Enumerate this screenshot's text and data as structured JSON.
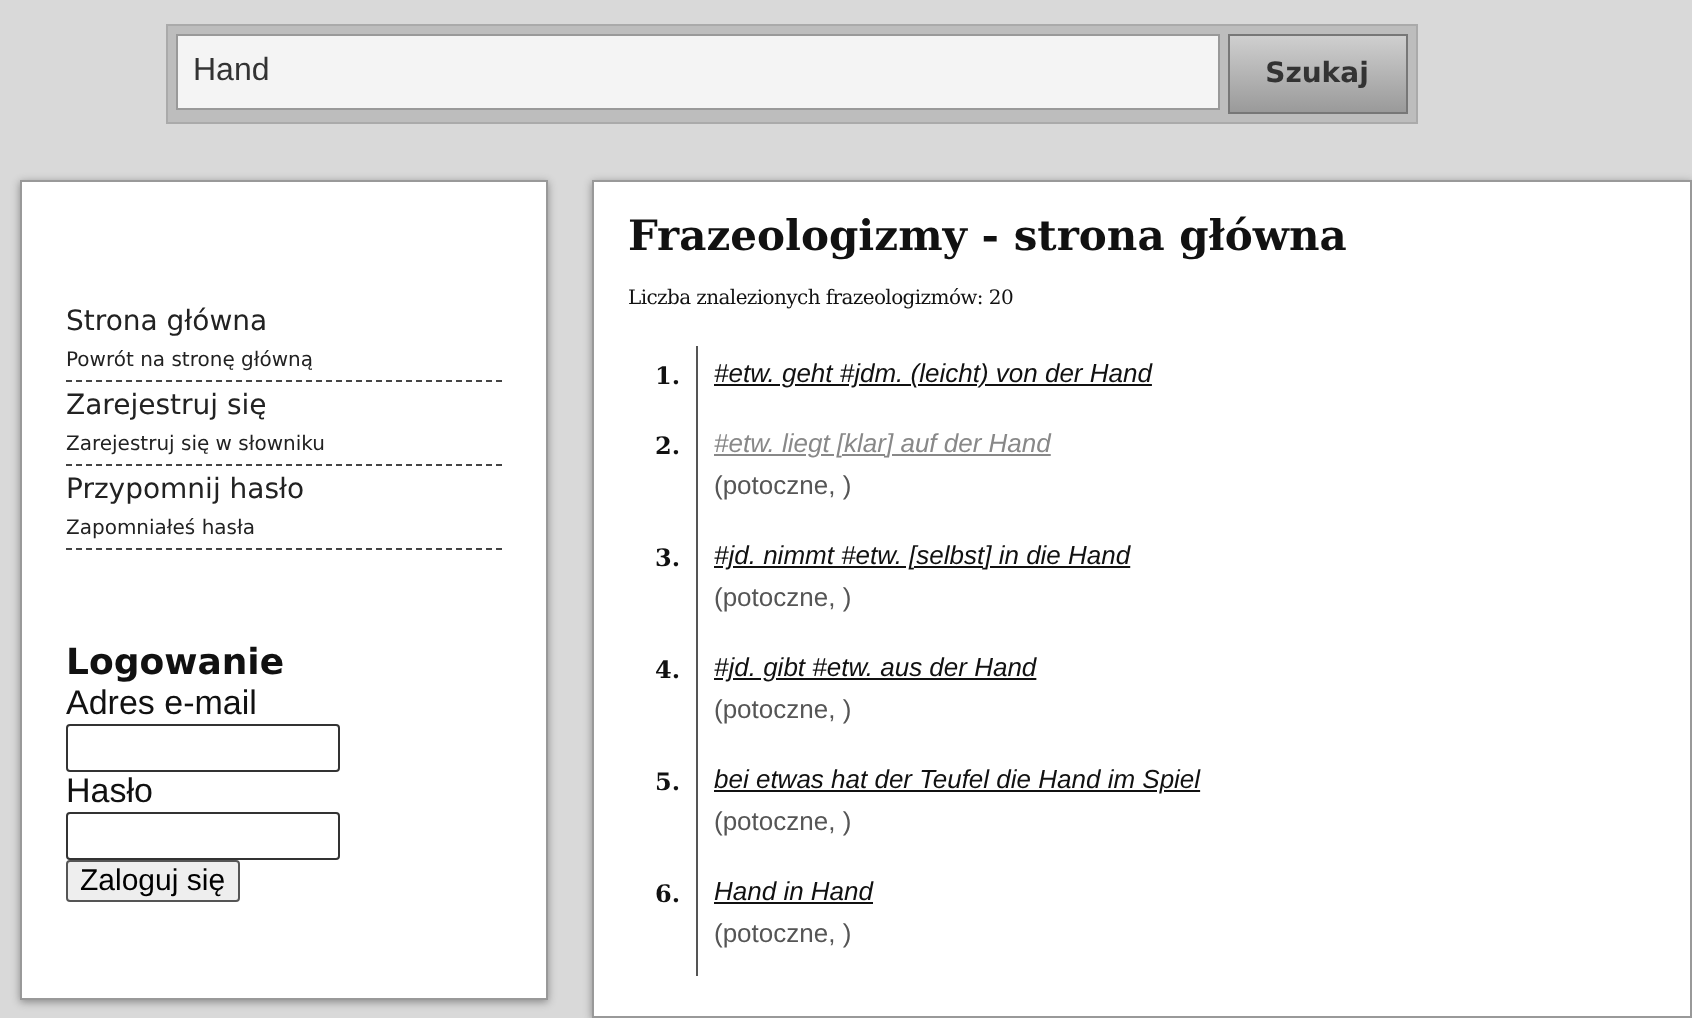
{
  "search": {
    "value": "Hand",
    "button": "Szukaj"
  },
  "sidebar": {
    "links": [
      {
        "title": "Strona główna",
        "subtitle": "Powrót na stronę główną"
      },
      {
        "title": "Zarejestruj się",
        "subtitle": "Zarejestruj się w słowniku"
      },
      {
        "title": "Przypomnij hasło",
        "subtitle": "Zapomniałeś hasła"
      }
    ],
    "login": {
      "heading": "Logowanie",
      "email_label": "Adres e-mail",
      "password_label": "Hasło",
      "button": "Zaloguj się"
    }
  },
  "main": {
    "title": "Frazeologizmy - strona główna",
    "count": "Liczba znalezionych frazeologizmów: 20",
    "results": [
      {
        "number": "1.",
        "phrase": "#etw. geht #jdm. (leicht) von der Hand",
        "visited": false
      },
      {
        "number": "2.",
        "phrase": "#etw. liegt [klar] auf der Hand",
        "note": "(potoczne, )",
        "visited": true
      },
      {
        "number": "3.",
        "phrase": "#jd. nimmt #etw. [selbst] in die Hand",
        "note": "(potoczne, )",
        "visited": false
      },
      {
        "number": "4.",
        "phrase": "#jd. gibt #etw. aus der Hand",
        "note": "(potoczne, )",
        "visited": false
      },
      {
        "number": "5.",
        "phrase": "bei etwas hat der Teufel die Hand im Spiel",
        "note": "(potoczne, )",
        "visited": false
      },
      {
        "number": "6.",
        "phrase": "Hand in Hand",
        "note": "(potoczne, )",
        "visited": false
      }
    ]
  }
}
